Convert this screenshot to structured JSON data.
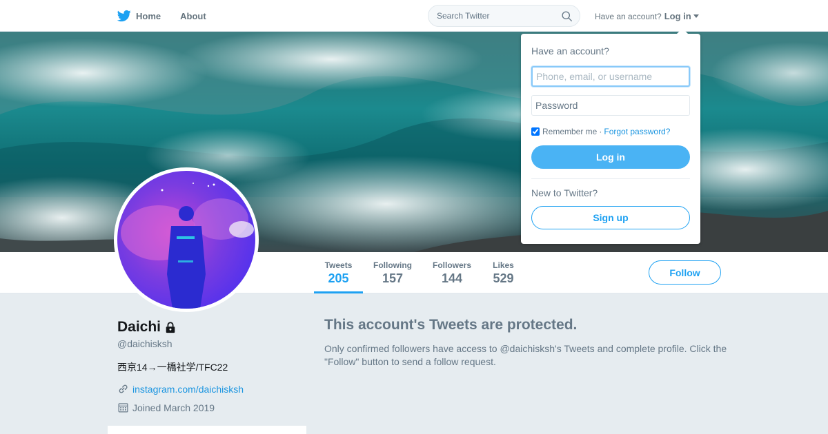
{
  "nav": {
    "home_label": "Home",
    "about_label": "About",
    "search_placeholder": "Search Twitter",
    "have_account": "Have an account?",
    "login_label": "Log in"
  },
  "profile": {
    "name": "Daichi",
    "handle": "@daichisksh",
    "bio": "西京14→一橋社学/TFC22",
    "url": "instagram.com/daichisksh",
    "joined": "Joined March 2019"
  },
  "stats": [
    {
      "label": "Tweets",
      "value": "205"
    },
    {
      "label": "Following",
      "value": "157"
    },
    {
      "label": "Followers",
      "value": "144"
    },
    {
      "label": "Likes",
      "value": "529"
    }
  ],
  "follow_label": "Follow",
  "protected": {
    "title": "This account's Tweets are protected.",
    "description": "Only confirmed followers have access to @daichisksh's Tweets and complete profile. Click the \"Follow\" button to send a follow request."
  },
  "login_dropdown": {
    "title": "Have an account?",
    "username_placeholder": "Phone, email, or username",
    "password_placeholder": "Password",
    "remember_label": "Remember me",
    "separator": "·",
    "forgot_label": "Forgot password?",
    "login_button": "Log in",
    "new_label": "New to Twitter?",
    "signup_button": "Sign up"
  },
  "colors": {
    "accent": "#1da1f2",
    "background": "#e6ecf0",
    "secondary_text": "#657786"
  },
  "icons": [
    "twitter-bird-icon",
    "home-icon",
    "search-icon",
    "lock-icon",
    "link-icon",
    "calendar-icon"
  ]
}
